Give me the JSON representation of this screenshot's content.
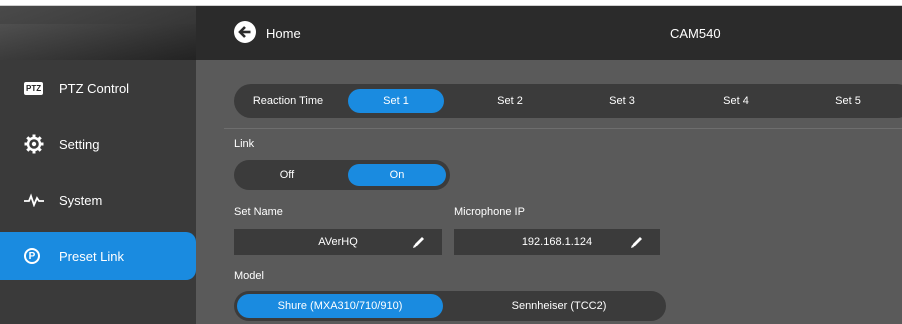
{
  "sidebar": {
    "items": [
      {
        "label": "PTZ Control",
        "icon": "ptz-icon",
        "icon_text": "PTZ"
      },
      {
        "label": "Setting",
        "icon": "gear-icon"
      },
      {
        "label": "System",
        "icon": "pulse-icon"
      },
      {
        "label": "Preset Link",
        "icon": "preset-link-icon",
        "icon_text": "P",
        "active": true
      }
    ]
  },
  "header": {
    "back_label": "Home",
    "device_name": "CAM540"
  },
  "tabs": {
    "reaction_time": "Reaction Time",
    "items": [
      "Set 1",
      "Set 2",
      "Set 3",
      "Set 4",
      "Set 5"
    ],
    "selected": "Set 1"
  },
  "link": {
    "label": "Link",
    "off": "Off",
    "on": "On",
    "selected": "On"
  },
  "set_name": {
    "label": "Set Name",
    "value": "AVerHQ"
  },
  "microphone_ip": {
    "label": "Microphone IP",
    "value": "192.168.1.124"
  },
  "model": {
    "label": "Model",
    "options": [
      "Shure (MXA310/710/910)",
      "Sennheiser (TCC2)"
    ],
    "selected": "Shure (MXA310/710/910)"
  },
  "colors": {
    "accent": "#1a8be0",
    "sidebar": "#3a3a3a",
    "topbar": "#2b2b2b",
    "main": "#5a5a5a",
    "pill": "#3b3b3b"
  }
}
